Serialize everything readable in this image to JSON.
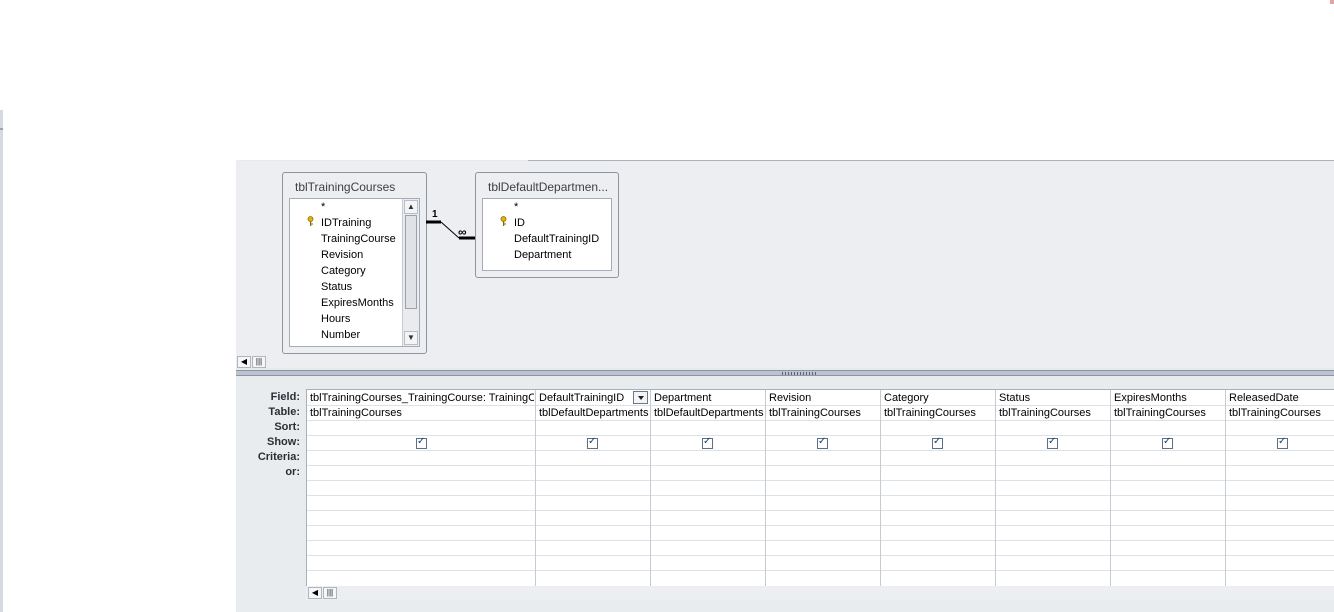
{
  "tables": [
    {
      "title": "tblTrainingCourses",
      "fields": [
        {
          "label": "*",
          "key": false
        },
        {
          "label": "IDTraining",
          "key": true
        },
        {
          "label": "TrainingCourse",
          "key": false
        },
        {
          "label": "Revision",
          "key": false
        },
        {
          "label": "Category",
          "key": false
        },
        {
          "label": "Status",
          "key": false
        },
        {
          "label": "ExpiresMonths",
          "key": false
        },
        {
          "label": "Hours",
          "key": false
        },
        {
          "label": "Number",
          "key": false
        }
      ]
    },
    {
      "title": "tblDefaultDepartmen...",
      "fields": [
        {
          "label": "*",
          "key": false
        },
        {
          "label": "ID",
          "key": true
        },
        {
          "label": "DefaultTrainingID",
          "key": false
        },
        {
          "label": "Department",
          "key": false
        }
      ]
    }
  ],
  "relationship": {
    "one_label": "1",
    "many_label": "∞"
  },
  "grid": {
    "row_labels": {
      "field": "Field:",
      "table": "Table:",
      "sort": "Sort:",
      "show": "Show:",
      "criteria": "Criteria:",
      "or": "or:"
    },
    "columns": [
      {
        "field": "tblTrainingCourses_TrainingCourse: TrainingCourse",
        "table": "tblTrainingCourses",
        "show": true
      },
      {
        "field": "DefaultTrainingID",
        "table": "tblDefaultDepartments",
        "show": true,
        "dropdown": true
      },
      {
        "field": "Department",
        "table": "tblDefaultDepartments",
        "show": true
      },
      {
        "field": "Revision",
        "table": "tblTrainingCourses",
        "show": true
      },
      {
        "field": "Category",
        "table": "tblTrainingCourses",
        "show": true
      },
      {
        "field": "Status",
        "table": "tblTrainingCourses",
        "show": true
      },
      {
        "field": "ExpiresMonths",
        "table": "tblTrainingCourses",
        "show": true
      },
      {
        "field": "ReleasedDate",
        "table": "tblTrainingCourses",
        "show": true
      }
    ]
  },
  "colors": {
    "pane_bg": "#eceef1",
    "grid_border": "#c5cbd3",
    "check": "#1d3c66"
  }
}
